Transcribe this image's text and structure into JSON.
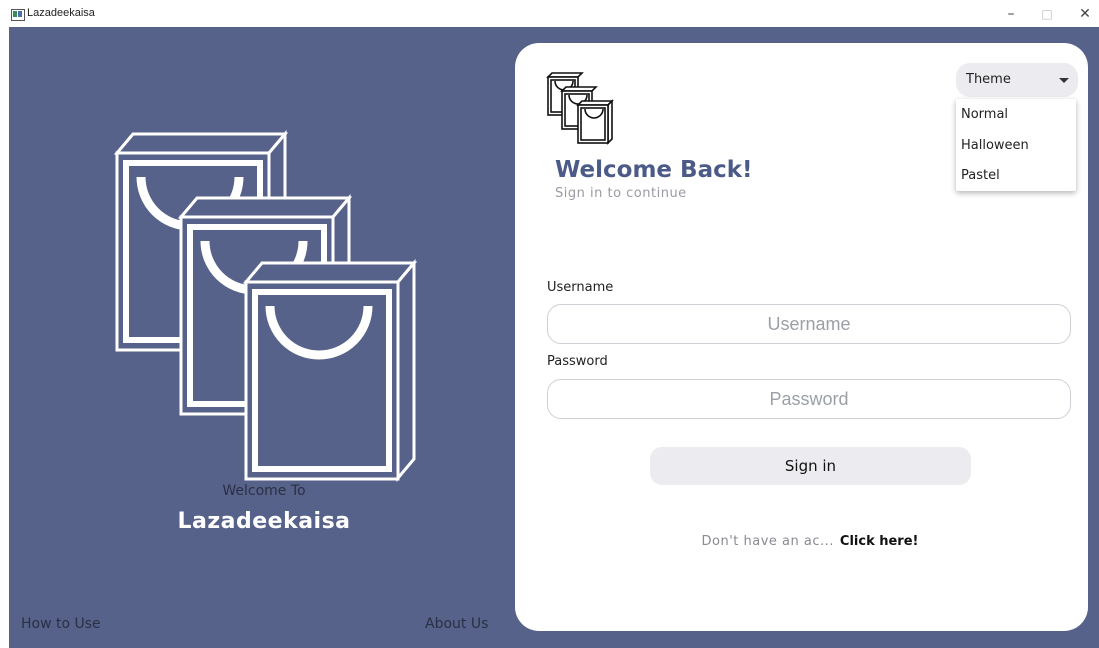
{
  "window": {
    "title": "Lazadeekaisa",
    "minimize": "–",
    "maximize": "□",
    "close": "✕"
  },
  "left_panel": {
    "welcome_to": "Welcome To",
    "brand": "Lazadeekaisa",
    "how_to_use": "How to Use",
    "about_us": "About Us",
    "bg_color": "#57628a"
  },
  "card": {
    "headline": "Welcome Back!",
    "subline": "Sign in to continue",
    "theme": {
      "label": "Theme",
      "options": [
        "Normal",
        "Halloween",
        "Pastel"
      ]
    },
    "username": {
      "label": "Username",
      "placeholder": "Username"
    },
    "password": {
      "label": "Password",
      "placeholder": "Password"
    },
    "sign_in": "Sign in",
    "signup_prompt": "Don't have an ac...",
    "signup_link": "Click here!",
    "accent_color": "#4c5a88"
  },
  "icons": {
    "illustration": "shopping-bags-icon",
    "card_logo": "shopping-bags-logo-icon",
    "app": "app-icon"
  }
}
